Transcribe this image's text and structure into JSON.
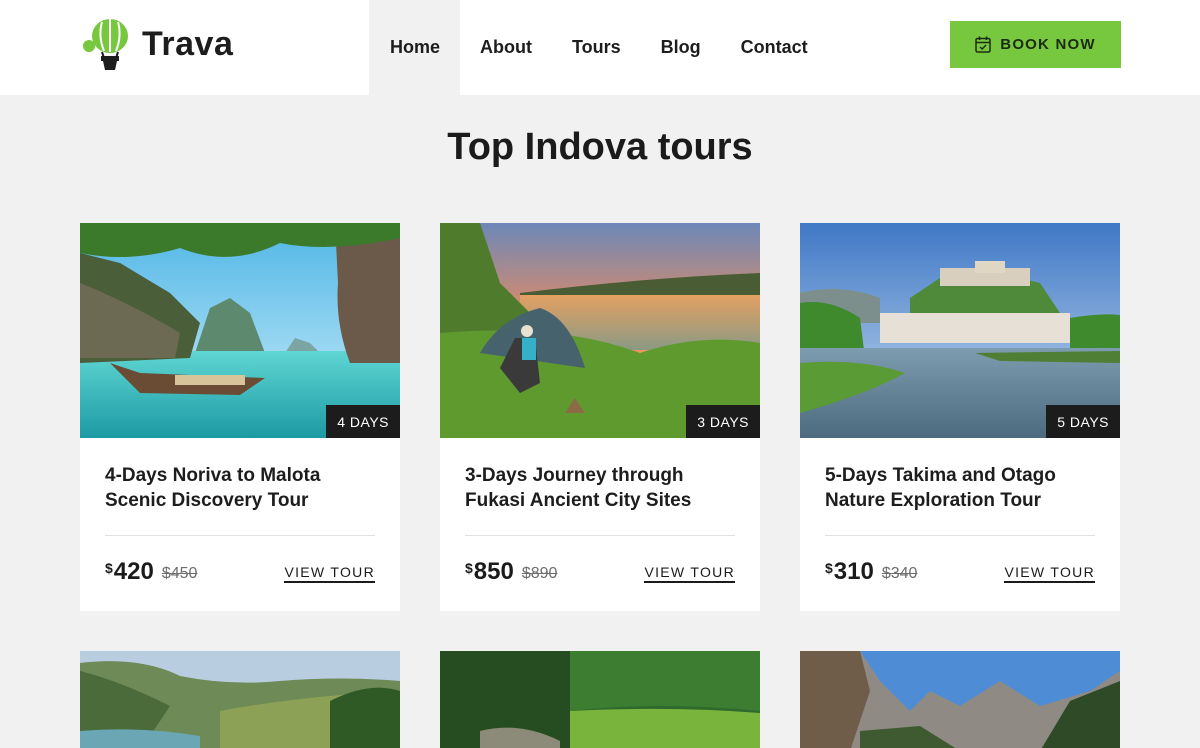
{
  "brand": {
    "name": "Trava",
    "accent": "#78c83f"
  },
  "nav": {
    "items": [
      {
        "label": "Home",
        "active": true
      },
      {
        "label": "About",
        "active": false
      },
      {
        "label": "Tours",
        "active": false
      },
      {
        "label": "Blog",
        "active": false
      },
      {
        "label": "Contact",
        "active": false
      }
    ],
    "book_button": {
      "label": "BOOK NOW",
      "icon": "calendar-check-icon"
    }
  },
  "section": {
    "title": "Top Indova tours"
  },
  "tours": [
    {
      "duration": "4 DAYS",
      "title_line1": "4-Days Noriva to Malota",
      "title_line2": "Scenic Discovery Tour",
      "currency": "$",
      "price": "420",
      "old_price": "$450",
      "cta": "VIEW TOUR"
    },
    {
      "duration": "3 DAYS",
      "title_line1": "3-Days Journey through",
      "title_line2": "Fukasi Ancient City Sites",
      "currency": "$",
      "price": "850",
      "old_price": "$890",
      "cta": "VIEW TOUR"
    },
    {
      "duration": "5 DAYS",
      "title_line1": "5-Days Takima and Otago",
      "title_line2": "Nature Exploration Tour",
      "currency": "$",
      "price": "310",
      "old_price": "$340",
      "cta": "VIEW TOUR"
    }
  ]
}
